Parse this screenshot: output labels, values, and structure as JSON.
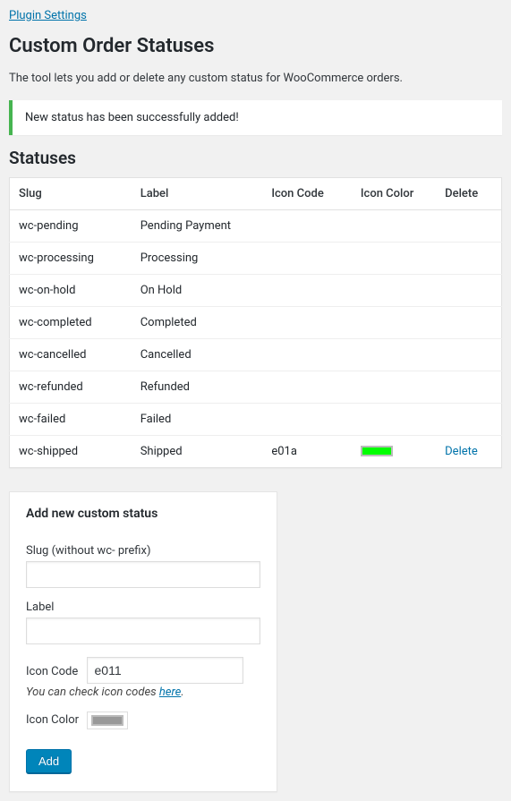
{
  "top_link": "Plugin Settings",
  "page_title": "Custom Order Statuses",
  "description": "The tool lets you add or delete any custom status for WooCommerce orders.",
  "notice": "New status has been successfully added!",
  "statuses_heading": "Statuses",
  "table": {
    "headers": {
      "slug": "Slug",
      "label": "Label",
      "icon_code": "Icon Code",
      "icon_color": "Icon Color",
      "delete": "Delete"
    },
    "rows": [
      {
        "slug": "wc-pending",
        "label": "Pending Payment",
        "icon_code": "",
        "icon_color": "",
        "deletable": false
      },
      {
        "slug": "wc-processing",
        "label": "Processing",
        "icon_code": "",
        "icon_color": "",
        "deletable": false
      },
      {
        "slug": "wc-on-hold",
        "label": "On Hold",
        "icon_code": "",
        "icon_color": "",
        "deletable": false
      },
      {
        "slug": "wc-completed",
        "label": "Completed",
        "icon_code": "",
        "icon_color": "",
        "deletable": false
      },
      {
        "slug": "wc-cancelled",
        "label": "Cancelled",
        "icon_code": "",
        "icon_color": "",
        "deletable": false
      },
      {
        "slug": "wc-refunded",
        "label": "Refunded",
        "icon_code": "",
        "icon_color": "",
        "deletable": false
      },
      {
        "slug": "wc-failed",
        "label": "Failed",
        "icon_code": "",
        "icon_color": "",
        "deletable": false
      },
      {
        "slug": "wc-shipped",
        "label": "Shipped",
        "icon_code": "e01a",
        "icon_color": "#00ff00",
        "deletable": true
      }
    ],
    "delete_label": "Delete"
  },
  "form": {
    "heading": "Add new custom status",
    "slug_label": "Slug (without wc- prefix)",
    "slug_value": "",
    "label_label": "Label",
    "label_value": "",
    "icon_code_label": "Icon Code",
    "icon_code_value": "e011",
    "help_prefix": "You can check icon codes ",
    "help_link": "here",
    "help_suffix": ".",
    "icon_color_label": "Icon Color",
    "icon_color_value": "#999999",
    "submit_label": "Add"
  }
}
